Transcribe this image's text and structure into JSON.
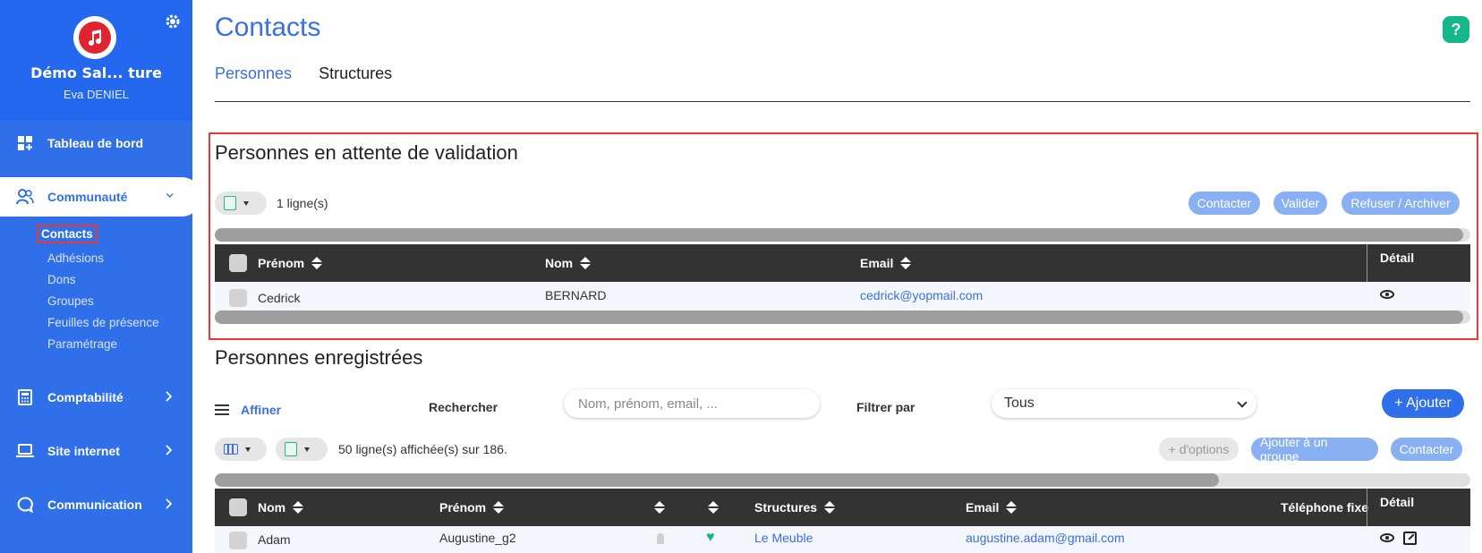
{
  "sidebar": {
    "org_name": "Démo Sal... ture",
    "user_name": "Eva DENIEL",
    "items": [
      {
        "label": "Tableau de bord",
        "icon": "dashboard-icon"
      },
      {
        "label": "Communauté",
        "icon": "community-icon"
      },
      {
        "label": "Comptabilité",
        "icon": "calculator-icon"
      },
      {
        "label": "Site internet",
        "icon": "laptop-icon"
      },
      {
        "label": "Communication",
        "icon": "chat-icon"
      }
    ],
    "subitems": [
      "Contacts",
      "Adhésions",
      "Dons",
      "Groupes",
      "Feuilles de présence",
      "Paramétrage"
    ]
  },
  "page": {
    "title": "Contacts",
    "help": "?",
    "tabs": [
      "Personnes",
      "Structures"
    ]
  },
  "pending": {
    "title": "Personnes en attente de validation",
    "count_text": "1 ligne(s)",
    "buttons": {
      "contact": "Contacter",
      "validate": "Valider",
      "refuse": "Refuser / Archiver"
    },
    "columns": {
      "firstname": "Prénom",
      "lastname": "Nom",
      "email": "Email",
      "detail": "Détail"
    },
    "rows": [
      {
        "firstname": "Cedrick",
        "lastname": "BERNARD",
        "email": "cedrick@yopmail.com"
      }
    ]
  },
  "registered": {
    "title": "Personnes enregistrées",
    "refine": "Affiner",
    "search_label": "Rechercher",
    "search_placeholder": "Nom, prénom, email, ...",
    "filter_label": "Filtrer par",
    "filter_value": "Tous",
    "add_button": "+ Ajouter",
    "count_text": "50 ligne(s) affichée(s) sur 186.",
    "buttons": {
      "more": "+ d'options",
      "add_group": "Ajouter à un groupe",
      "contact": "Contacter"
    },
    "scroll_fraction": 0.8,
    "columns": {
      "lastname": "Nom",
      "firstname": "Prénom",
      "structures": "Structures",
      "email": "Email",
      "phone": "Téléphone fixe",
      "detail": "Détail"
    },
    "rows": [
      {
        "lastname": "Adam",
        "firstname": "Augustine_g2",
        "structure": "Le Meuble",
        "email": "augustine.adam@gmail.com"
      }
    ]
  },
  "colors": {
    "accent": "#2f6fea",
    "highlight": "#e53935",
    "green": "#14b789"
  }
}
